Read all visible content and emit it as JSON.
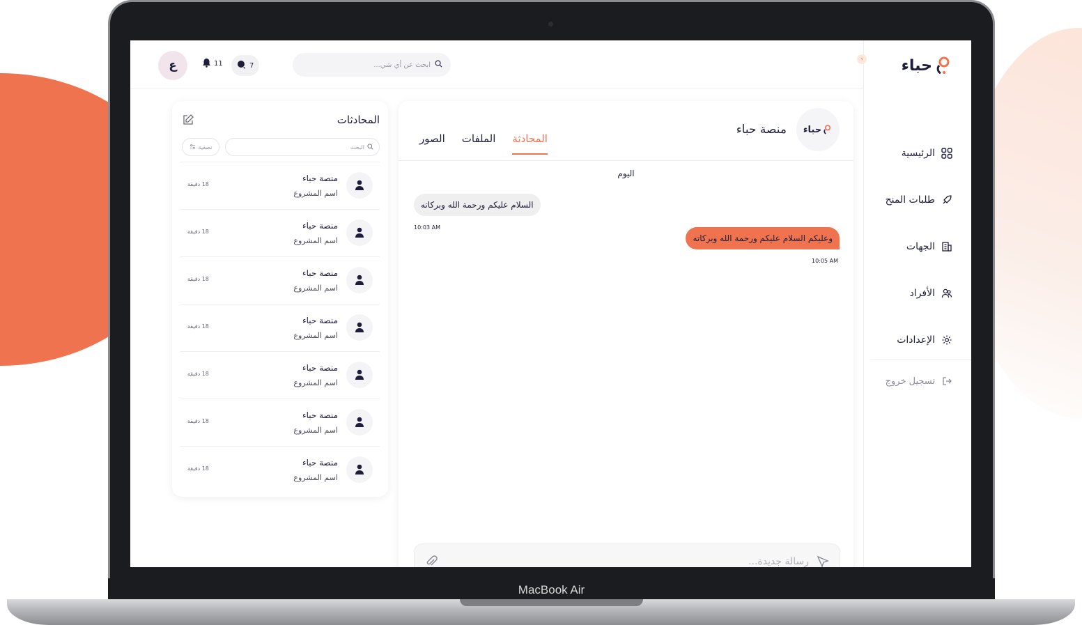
{
  "device": {
    "label": "MacBook Air"
  },
  "brand": {
    "name": "حباء",
    "accent": "#f07350",
    "text_color": "#1e1e3a"
  },
  "sidebar": {
    "items": [
      {
        "label": "الرئيسية",
        "icon": "grid-icon"
      },
      {
        "label": "طلبات المنح",
        "icon": "rocket-icon"
      },
      {
        "label": "الجهات",
        "icon": "building-icon"
      },
      {
        "label": "الأفراد",
        "icon": "users-icon"
      },
      {
        "label": "الإعدادات",
        "icon": "gear-icon"
      }
    ],
    "logout_label": "تسجيل خروج"
  },
  "header": {
    "search_placeholder": "ابحث عن أي شي...",
    "notifications_count": "11",
    "messages_count": "7",
    "user_initial": "ع"
  },
  "chat": {
    "title": "منصة حباء",
    "logo_text": "حباء",
    "tabs": [
      {
        "label": "المحادثة",
        "active": true
      },
      {
        "label": "الملفات",
        "active": false
      },
      {
        "label": "الصور",
        "active": false
      }
    ],
    "day_label": "اليوم",
    "messages": [
      {
        "text": "السلام عليكم ورحمة الله وبركاته",
        "time": "10:03 AM",
        "direction": "incoming"
      },
      {
        "text": "وعليكم السلام عليكم ورحمة الله وبركاته",
        "time": "10:05 AM",
        "direction": "outgoing"
      }
    ],
    "composer_placeholder": "رسالة جديدة..."
  },
  "conversations": {
    "title": "المحادثات",
    "search_placeholder": "البحث",
    "filter_label": "تصفية",
    "items": [
      {
        "name": "منصة حباء",
        "subtitle": "اسم المشروع",
        "time": "18 دقيقة"
      },
      {
        "name": "منصة حباء",
        "subtitle": "اسم المشروع",
        "time": "18 دقيقة"
      },
      {
        "name": "منصة حباء",
        "subtitle": "اسم المشروع",
        "time": "18 دقيقة"
      },
      {
        "name": "منصة حباء",
        "subtitle": "اسم المشروع",
        "time": "18 دقيقة"
      },
      {
        "name": "منصة حباء",
        "subtitle": "اسم المشروع",
        "time": "18 دقيقة"
      },
      {
        "name": "منصة حباء",
        "subtitle": "اسم المشروع",
        "time": "18 دقيقة"
      },
      {
        "name": "منصة حباء",
        "subtitle": "اسم المشروع",
        "time": "18 دقيقة"
      }
    ]
  }
}
